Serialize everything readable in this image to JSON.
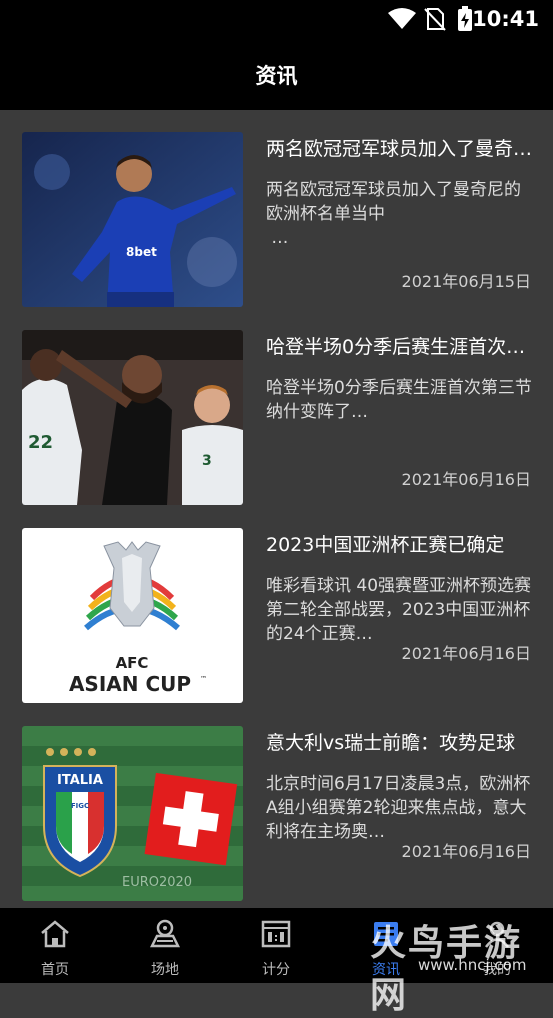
{
  "status_bar": {
    "time": "10:41"
  },
  "header": {
    "title": "资讯"
  },
  "articles": [
    {
      "title": "两名欧冠冠军球员加入了曼奇尼的欧洲杯名单当中",
      "summary": "两名欧冠冠军球员加入了曼奇尼的欧洲杯名单当中\n…",
      "date": "2021年06月15日"
    },
    {
      "title": "哈登半场0分季后赛生涯首次第三节纳什变阵了",
      "summary": "哈登半场0分季后赛生涯首次第三节纳什变阵了…",
      "date": "2021年06月16日"
    },
    {
      "title": "2023中国亚洲杯正赛已确定",
      "summary": "唯彩看球讯 40强赛暨亚洲杯预选赛第二轮全部战罢，2023中国亚洲杯的24个正赛…",
      "date": "2021年06月16日"
    },
    {
      "title": "意大利vs瑞士前瞻：攻势足球",
      "summary": "北京时间6月17日凌晨3点，欧洲杯A组小组赛第2轮迎来焦点战，意大利将在主场奥…",
      "date": "2021年06月16日"
    }
  ],
  "thumb_text": {
    "asian_cup_line1": "AFC",
    "asian_cup_line2": "ASIAN CUP",
    "asian_cup_tm": "™",
    "italia": "ITALIA",
    "figc": "FIGC",
    "euro": "EURO2020",
    "player_brand": "8bet",
    "jersey1": "22",
    "jersey2": "3"
  },
  "tabs": [
    {
      "label": "首页",
      "icon": "home-icon"
    },
    {
      "label": "场地",
      "icon": "stadium-icon"
    },
    {
      "label": "计分",
      "icon": "scoreboard-icon"
    },
    {
      "label": "资讯",
      "icon": "news-icon",
      "active": true
    },
    {
      "label": "我的",
      "icon": "profile-icon"
    }
  ],
  "watermark": {
    "text": "火鸟手游网",
    "url": "www.hncj.com"
  },
  "colors": {
    "active_tab": "#3b7df0",
    "background": "#3b3b3b",
    "bar": "#000000"
  }
}
